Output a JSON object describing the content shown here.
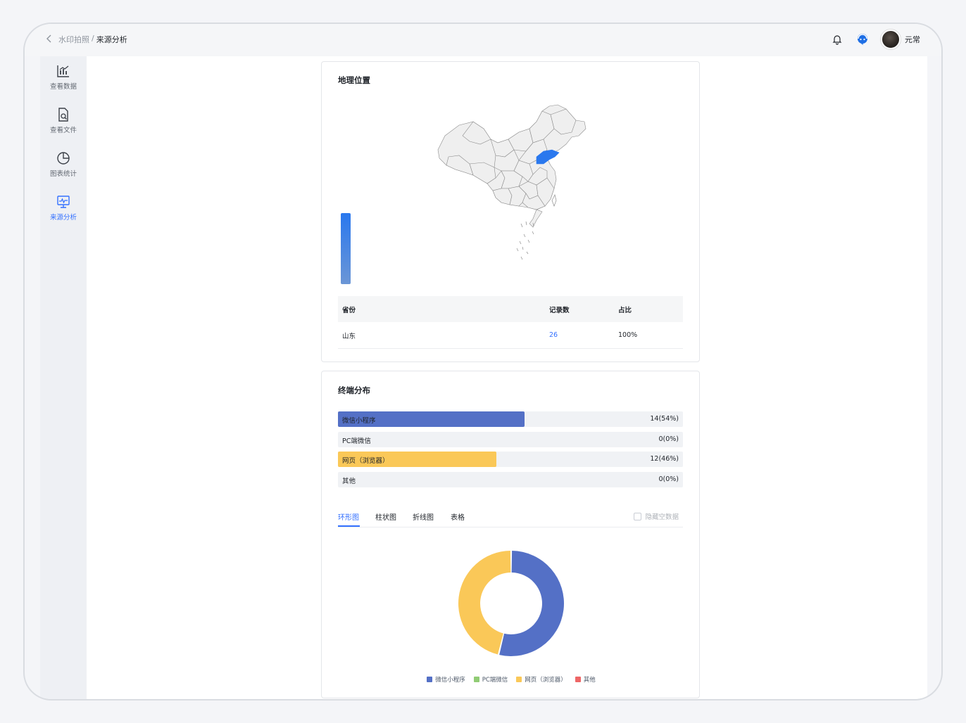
{
  "breadcrumb": {
    "parent": "水印拍照",
    "separator": "/",
    "current": "来源分析"
  },
  "user": {
    "name": "元常"
  },
  "sidebar": {
    "items": [
      {
        "label": "查看数据",
        "icon": "bar-chart-icon",
        "active": false
      },
      {
        "label": "查看文件",
        "icon": "file-search-icon",
        "active": false
      },
      {
        "label": "图表统计",
        "icon": "pie-chart-icon",
        "active": false
      },
      {
        "label": "来源分析",
        "icon": "monitor-pulse-icon",
        "active": true
      }
    ]
  },
  "geo": {
    "title": "地理位置",
    "headers": {
      "province": "省份",
      "records": "记录数",
      "ratio": "占比"
    },
    "rows": [
      {
        "province": "山东",
        "records": "26",
        "ratio": "100%"
      }
    ],
    "highlight_color": "#2a78ee"
  },
  "terminal": {
    "title": "终端分布",
    "items": [
      {
        "label": "微信小程序",
        "value": "14(54%)",
        "share": 0.54,
        "color": "#5470c6"
      },
      {
        "label": "PC端微信",
        "value": "0(0%)",
        "share": 0,
        "color": "#91cc75"
      },
      {
        "label": "网页（浏览器）",
        "value": "12(46%)",
        "share": 0.46,
        "color": "#fac858"
      },
      {
        "label": "其他",
        "value": "0(0%)",
        "share": 0,
        "color": "#ee6666"
      }
    ],
    "tabs": [
      "环形图",
      "柱状图",
      "折线图",
      "表格"
    ],
    "active_tab": 0,
    "hide_empty_label": "隐藏空数据"
  },
  "chart_data": {
    "type": "pie",
    "categories": [
      "微信小程序",
      "PC端微信",
      "网页（浏览器）",
      "其他"
    ],
    "values": [
      14,
      0,
      12,
      0
    ],
    "colors": [
      "#5470c6",
      "#91cc75",
      "#fac858",
      "#ee6666"
    ],
    "title": "",
    "legend": "bottom"
  }
}
